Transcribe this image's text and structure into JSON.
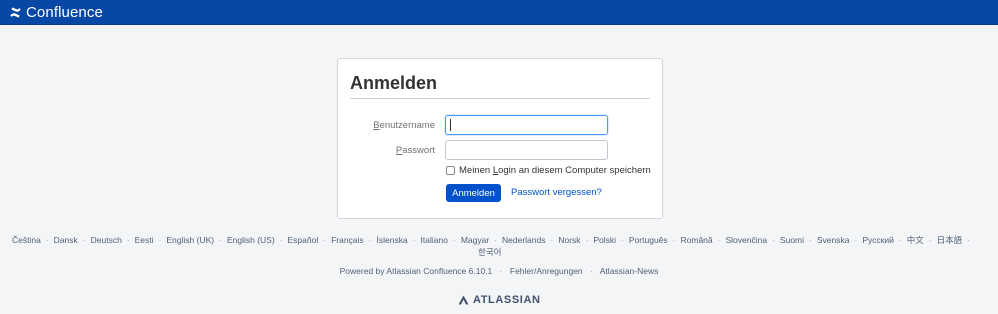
{
  "header": {
    "brand": "Confluence",
    "bg_color": "#0747a6"
  },
  "login": {
    "title": "Anmelden",
    "username_label_pre": "",
    "username_label_u": "B",
    "username_label_post": "enutzername",
    "username_value": "",
    "password_label_u": "P",
    "password_label_post": "asswort",
    "password_value": "",
    "remember_pre": "Meinen ",
    "remember_u": "L",
    "remember_post": "ogin an diesem Computer speichern",
    "remember_checked": false,
    "submit_label": "Anmelden",
    "forgot_label": "Passwort vergessen?",
    "accent_color": "#0052cc"
  },
  "languages": [
    "Čeština",
    "Dansk",
    "Deutsch",
    "Eesti",
    "English (UK)",
    "English (US)",
    "Español",
    "Français",
    "Íslenska",
    "Italiano",
    "Magyar",
    "Nederlands",
    "Norsk",
    "Polski",
    "Português",
    "Română",
    "Slovenčina",
    "Suomi",
    "Svenska",
    "Русский",
    "中文",
    "日本語",
    "한국어"
  ],
  "footer": {
    "powered_by": "Powered by Atlassian Confluence 6.10.1",
    "feedback": "Fehler/Anregungen",
    "news": "Atlassian-News",
    "atlassian_logo": "ATLASSIAN"
  }
}
